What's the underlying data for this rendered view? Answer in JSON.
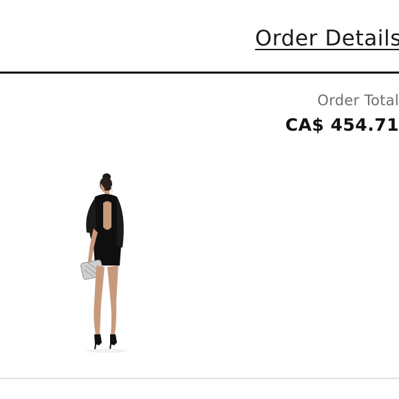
{
  "header": {
    "order_details_link": "Order Details"
  },
  "summary": {
    "total_label": "Order Total",
    "total_value": "CA$ 454.71"
  },
  "items": [
    {
      "image_icon": "product-photo-icon"
    }
  ],
  "colors": {
    "text": "#111111",
    "muted": "#6e6e6e",
    "divider": "#111111",
    "light_divider": "#e2e2e2"
  }
}
